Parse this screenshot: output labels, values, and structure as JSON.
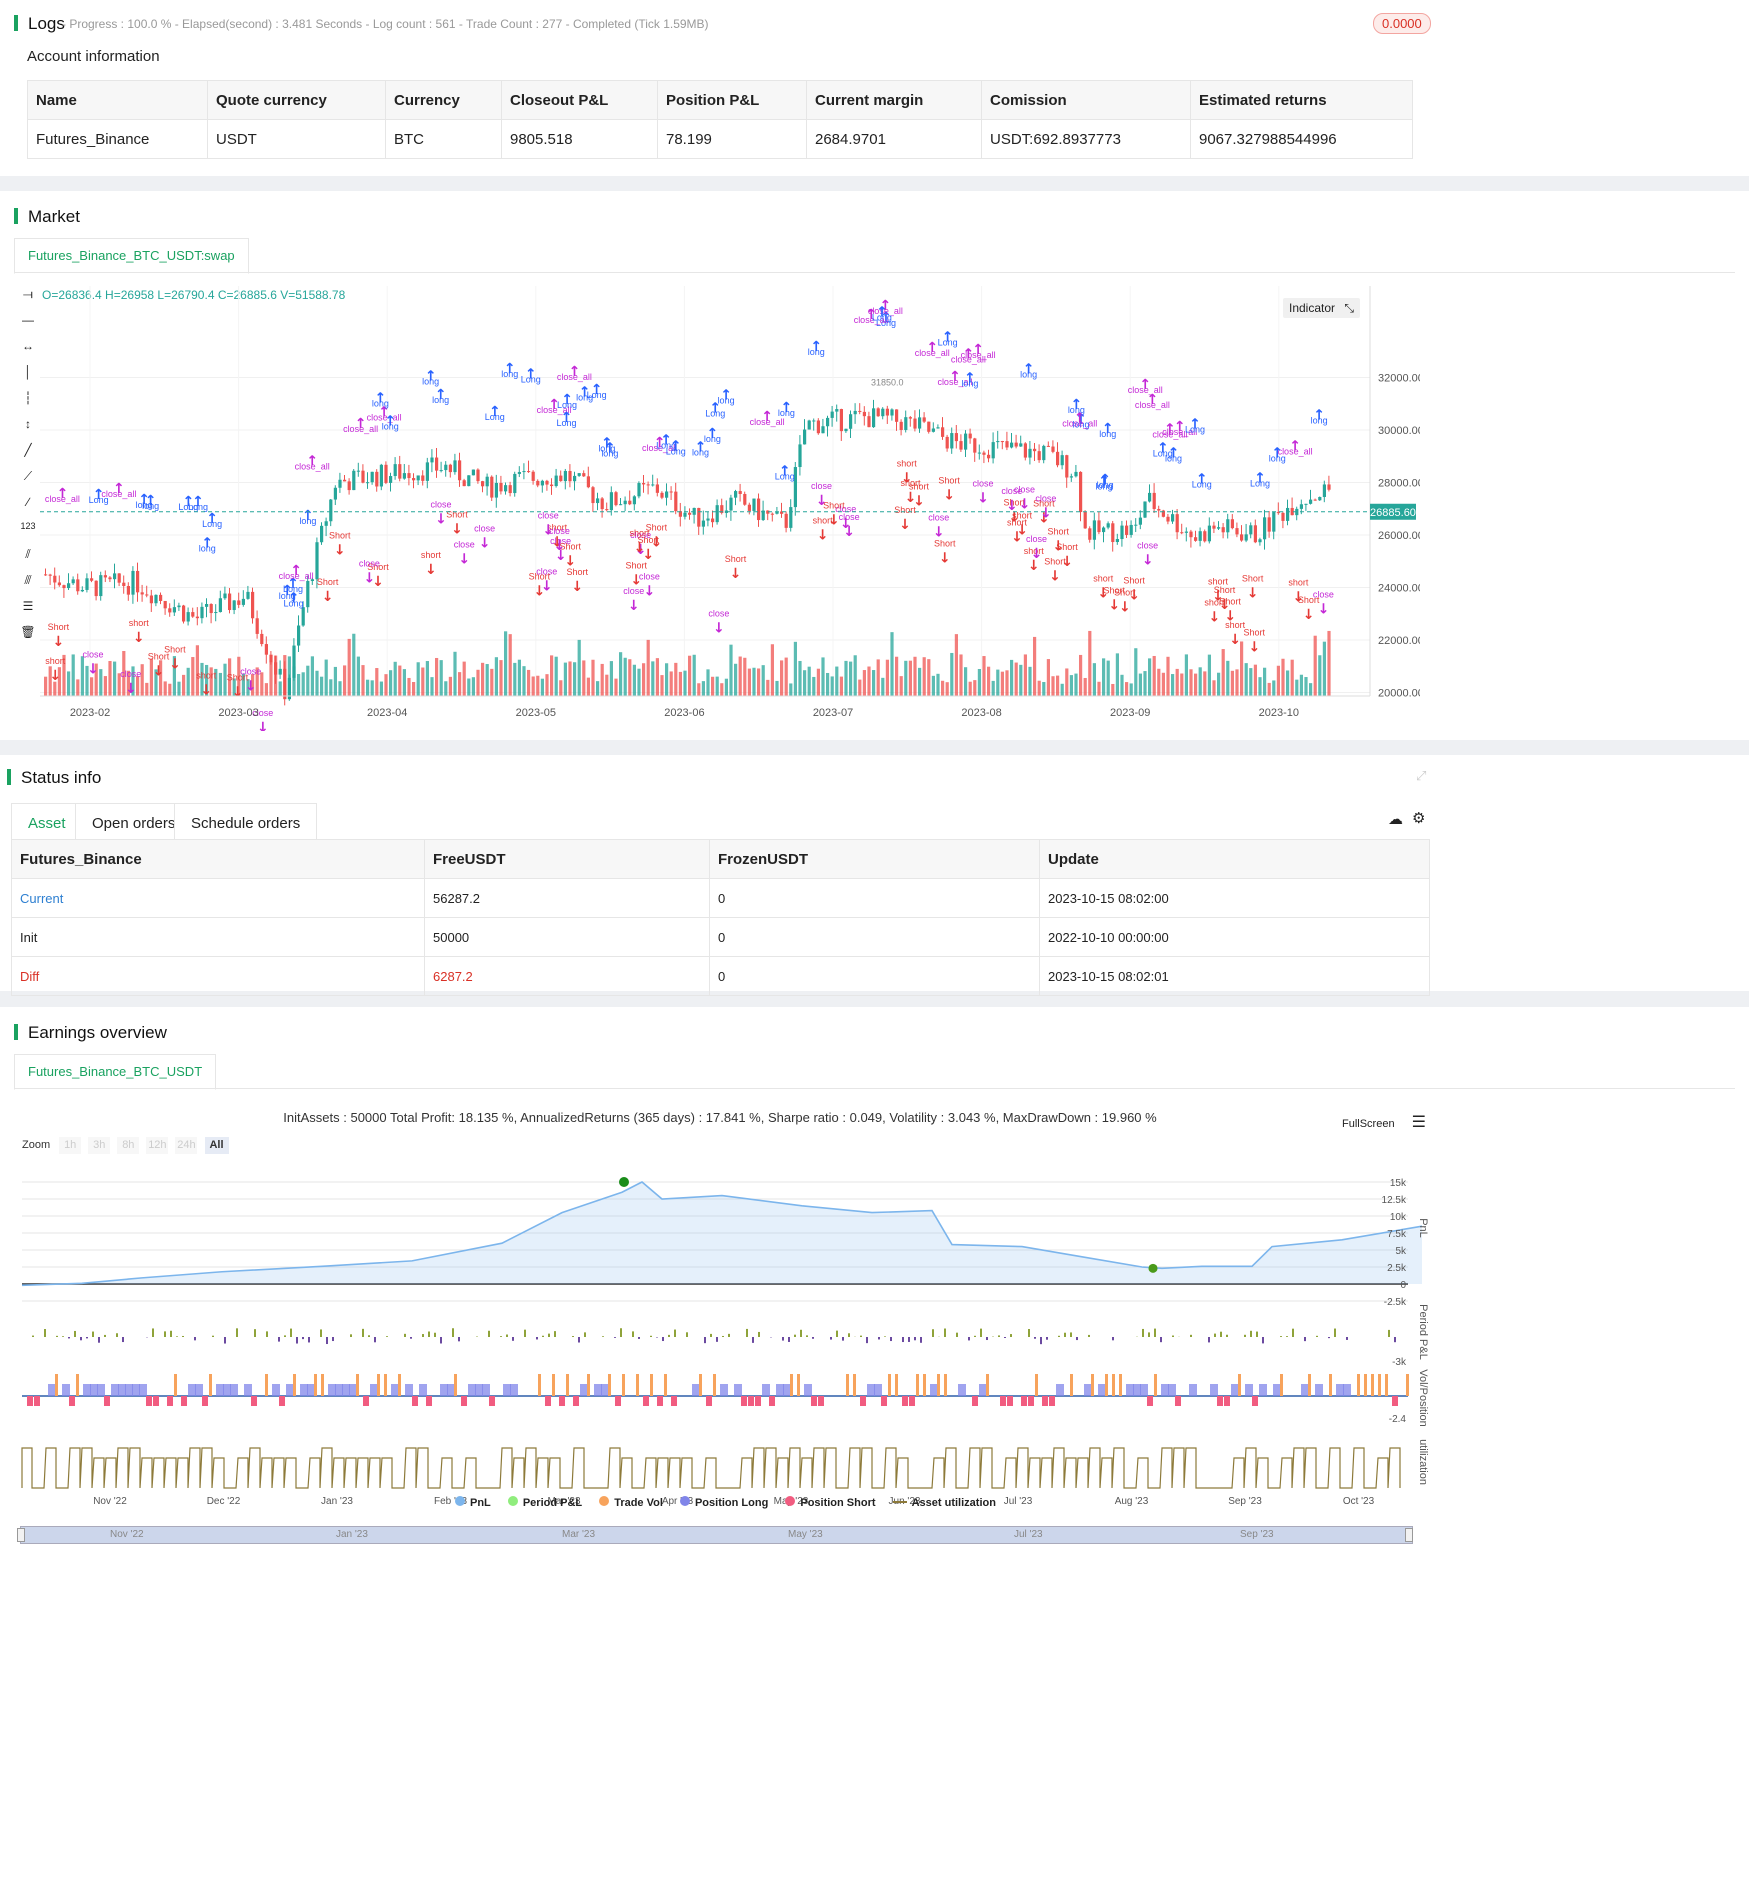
{
  "logs": {
    "title": "Logs",
    "summary": "- Progress : 100.0 % - Elapsed(second) : 3.481 Seconds - Log count : 561 - Trade Count : 277 - Completed (Tick 1.59MB)",
    "badge": "0.0000"
  },
  "account": {
    "title": "Account information",
    "headers": [
      "Name",
      "Quote currency",
      "Currency",
      "Closeout P&L",
      "Position P&L",
      "Current margin",
      "Comission",
      "Estimated returns"
    ],
    "row": [
      "Futures_Binance",
      "USDT",
      "BTC",
      "9805.518",
      "78.199",
      "2684.9701",
      "USDT:692.8937773",
      "9067.327988544996"
    ]
  },
  "market": {
    "title": "Market",
    "tab": "Futures_Binance_BTC_USDT:swap",
    "ohlc": "O=26836.4 H=26958 L=26790.4 C=26885.6 V=51588.78",
    "indicator_btn": "Indicator",
    "last_price": "26885.60",
    "peak_label": "31850.0",
    "y_ticks": [
      "32000.00",
      "30000.00",
      "28000.00",
      "26000.00",
      "24000.00",
      "22000.00",
      "20000.00"
    ],
    "x_ticks": [
      "2023-02",
      "2023-03",
      "2023-04",
      "2023-05",
      "2023-06",
      "2023-07",
      "2023-08",
      "2023-09",
      "2023-10"
    ],
    "colors": {
      "up": "#26a69a",
      "down": "#ef5350",
      "long": "#2962ff",
      "short": "#e53935",
      "close": "#c428d6"
    }
  },
  "status": {
    "title": "Status info",
    "tabs": [
      "Asset",
      "Open orders",
      "Schedule orders"
    ],
    "headers": [
      "Futures_Binance",
      "FreeUSDT",
      "FrozenUSDT",
      "Update"
    ],
    "rows": [
      [
        "Current",
        "56287.2",
        "0",
        "2023-10-15 08:02:00"
      ],
      [
        "Init",
        "50000",
        "0",
        "2022-10-10 00:00:00"
      ],
      [
        "Diff",
        "6287.2",
        "0",
        "2023-10-15 08:02:01"
      ]
    ]
  },
  "earnings": {
    "title": "Earnings overview",
    "tab": "Futures_Binance_BTC_USDT",
    "summary": "InitAssets : 50000 Total Profit: 18.135 %, AnnualizedReturns (365 days) : 17.841 %, Sharpe ratio : 0.049, Volatility : 3.043 %, MaxDrawDown : 19.960 %",
    "fullscreen": "FullScreen",
    "zoom_label": "Zoom",
    "zoom_options": [
      "1h",
      "3h",
      "8h",
      "12h",
      "24h",
      "All"
    ],
    "pnl_ticks": [
      "15k",
      "12.5k",
      "10k",
      "7.5k",
      "5k",
      "2.5k",
      "0",
      "-2.5k"
    ],
    "period_tick": "-3k",
    "vol_tick": "-2.4",
    "axis_titles": [
      "PnL",
      "Period P&L",
      "Vol/Position",
      "utilization"
    ],
    "x_ticks": [
      "Nov '22",
      "Dec '22",
      "Jan '23",
      "Feb '23",
      "Mar '23",
      "Apr '23",
      "May '23",
      "Jun '23",
      "Jul '23",
      "Aug '23",
      "Sep '23",
      "Oct '23"
    ],
    "nav_ticks": [
      "Nov '22",
      "Jan '23",
      "Mar '23",
      "May '23",
      "Jul '23",
      "Sep '23"
    ],
    "legend": [
      {
        "label": "PnL",
        "color": "#7cb5ec"
      },
      {
        "label": "Period P&L",
        "color": "#90ed7d"
      },
      {
        "label": "Trade Vol",
        "color": "#f7a35c"
      },
      {
        "label": "Position Long",
        "color": "#8085e9"
      },
      {
        "label": "Position Short",
        "color": "#f15c80"
      },
      {
        "label": "Asset utilization",
        "color": "#8d7a3a"
      }
    ]
  }
}
